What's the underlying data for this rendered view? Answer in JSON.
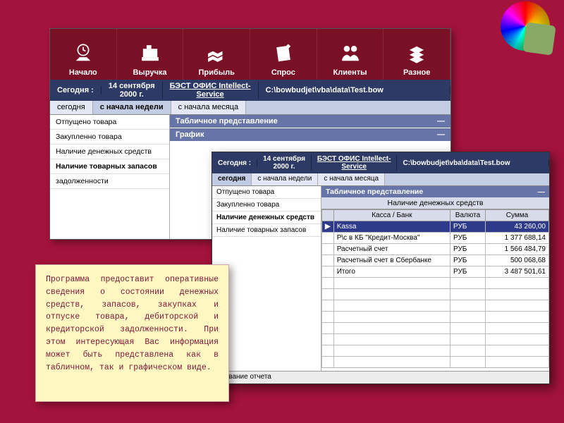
{
  "toolbar": {
    "items": [
      {
        "label": "Начало"
      },
      {
        "label": "Выручка"
      },
      {
        "label": "Прибыль"
      },
      {
        "label": "Спрос"
      },
      {
        "label": "Клиенты"
      },
      {
        "label": "Разное"
      }
    ]
  },
  "status": {
    "today_label": "Сегодня :",
    "date_line1": "14 сентября",
    "date_line2": "2000 г.",
    "product_line1": "БЭСТ ОФИС Intellect-",
    "product_line2": "Service",
    "path": "C:\\bowbudjet\\vba\\data\\Test.bow"
  },
  "period_tabs": {
    "today": "сегодня",
    "week": "с начала недели",
    "month": "с начала месяца"
  },
  "sidebar_main": {
    "items": [
      "Отпущено товара",
      "Закупленно товара",
      "Наличие денежных средств",
      "Наличие товарных запасов",
      "задолженности"
    ],
    "selected": "Наличие товарных запасов"
  },
  "mainpane": {
    "header_table": "Табличное представление",
    "header_chart": "График"
  },
  "front": {
    "sidebar": {
      "items": [
        "Отпущено товара",
        "Закупленно товара",
        "Наличие денежных средств",
        "Наличие товарных запасов"
      ],
      "selected": "Наличие денежных средств"
    },
    "table": {
      "pane_header": "Табличное представление",
      "title": "Наличие денежных средств",
      "cols": {
        "c1": "Касса / Банк",
        "c2": "Валюта",
        "c3": "Сумма"
      },
      "rows": [
        {
          "mark": "▶",
          "name": "Kassa",
          "cur": "РУБ",
          "sum": "43 260,00",
          "sel": true
        },
        {
          "mark": "",
          "name": "Р\\с в КБ \"Кредит-Москва\"",
          "cur": "РУБ",
          "sum": "1 377 688,14"
        },
        {
          "mark": "",
          "name": "Расчетный счет",
          "cur": "РУБ",
          "sum": "1 566 484,79"
        },
        {
          "mark": "",
          "name": "Расчетный счет в Сбербанке",
          "cur": "РУБ",
          "sum": "500 068,68"
        },
        {
          "mark": "",
          "name": "Итого",
          "cur": "РУБ",
          "sum": "3 487 501,61"
        }
      ],
      "footer": "Название отчета"
    }
  },
  "note": {
    "text": "Программа предоставит оперативные сведения о состоянии денежных средств, запасов, закупках и отпуске товара, дебиторской и кредиторской задолженности. При этом интересующая Вас информация может быть представлена как в табличном, так и графическом виде."
  }
}
